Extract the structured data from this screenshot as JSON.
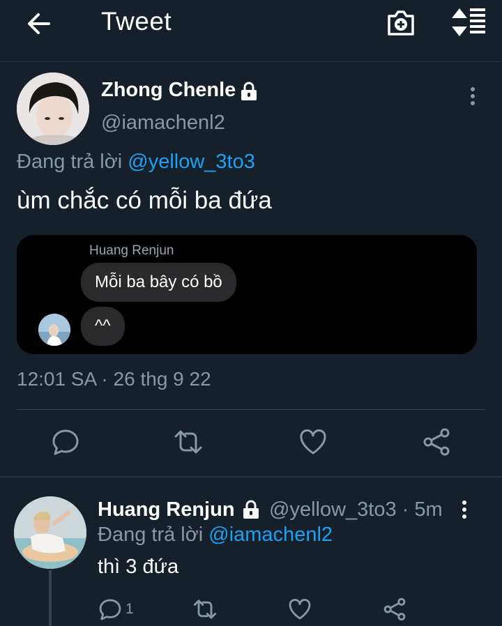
{
  "header": {
    "title": "Tweet",
    "back_icon": "arrow-left-icon",
    "camera_icon": "camera-plus-icon",
    "sort_icon": "sort-list-icon"
  },
  "tweet": {
    "author_name": "Zhong Chenle",
    "author_handle": "@iamachenl2",
    "replying_prefix": "Đang trả lời",
    "replying_to": "@yellow_3to3",
    "text": "ùm chắc có mỗi ba đứa",
    "embedded": {
      "sender_name": "Huang Renjun",
      "messages": [
        "Mỗi ba bây có bồ",
        "^^"
      ]
    },
    "timestamp": "12:01 SA · 26 thg 9 22",
    "actions": [
      "reply-icon",
      "retweet-icon",
      "like-icon",
      "share-icon"
    ]
  },
  "reply": {
    "author_name": "Huang Renjun",
    "author_handle": "@yellow_3to3 · 5m",
    "replying_prefix": "Đang trả lời",
    "replying_to": "@iamachenl2",
    "text": "thì 3 đứa",
    "reply_count": "1"
  },
  "colors": {
    "background": "#15202b",
    "accent": "#1da1f2",
    "secondary_text": "#8899a6",
    "divider": "#38444d"
  }
}
